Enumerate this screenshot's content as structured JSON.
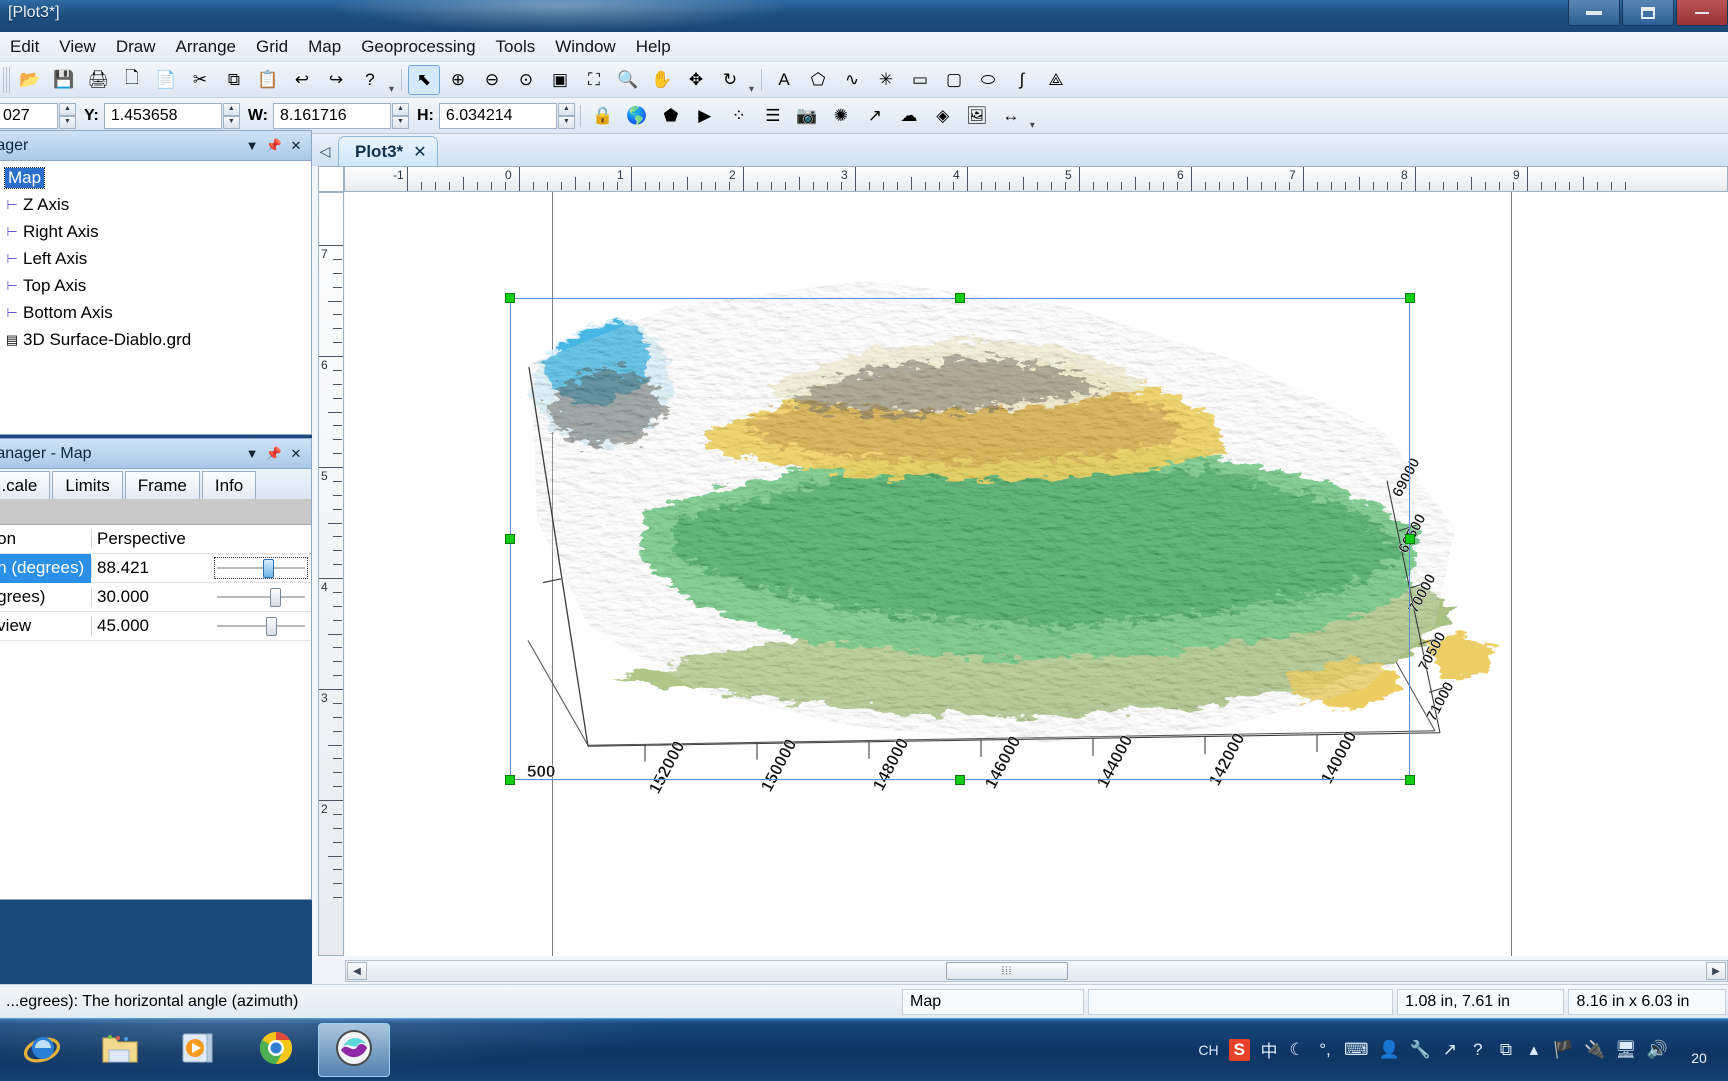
{
  "window": {
    "title": "[Plot3*]",
    "buttons": {
      "minimize": "minimize",
      "maximize": "maximize",
      "close": "close"
    }
  },
  "menu": {
    "items": [
      "Edit",
      "View",
      "Draw",
      "Arrange",
      "Grid",
      "Map",
      "Geoprocessing",
      "Tools",
      "Window",
      "Help"
    ]
  },
  "toolbars": {
    "standard": [
      {
        "name": "open-icon",
        "glyph": "📂"
      },
      {
        "name": "save-icon",
        "glyph": "💾"
      },
      {
        "name": "print-icon",
        "glyph": "🖨"
      },
      {
        "name": "print-preview-icon",
        "glyph": "🗋"
      },
      {
        "name": "export-icon",
        "glyph": "📄"
      },
      {
        "name": "cut-icon",
        "glyph": "✂"
      },
      {
        "name": "copy-icon",
        "glyph": "⧉"
      },
      {
        "name": "paste-icon",
        "glyph": "📋"
      },
      {
        "name": "undo-icon",
        "glyph": "↩"
      },
      {
        "name": "redo-icon",
        "glyph": "↪"
      },
      {
        "name": "help-pointer-icon",
        "glyph": "?"
      }
    ],
    "view": [
      {
        "name": "select-tool-icon",
        "glyph": "⬉"
      },
      {
        "name": "zoom-in-icon",
        "glyph": "⊕"
      },
      {
        "name": "zoom-out-icon",
        "glyph": "⊖"
      },
      {
        "name": "zoom-selected-icon",
        "glyph": "⊙"
      },
      {
        "name": "zoom-rectangle-icon",
        "glyph": "▣"
      },
      {
        "name": "fit-window-icon",
        "glyph": "⛶"
      },
      {
        "name": "zoom-page-icon",
        "glyph": "🔍"
      },
      {
        "name": "pan-icon",
        "glyph": "✋"
      },
      {
        "name": "trackball-rotate-icon",
        "glyph": "✥"
      },
      {
        "name": "reset-rotate-icon",
        "glyph": "↻"
      }
    ],
    "draw": [
      {
        "name": "text-icon",
        "glyph": "A"
      },
      {
        "name": "polygon-icon",
        "glyph": "⬠"
      },
      {
        "name": "polyline-icon",
        "glyph": "∿"
      },
      {
        "name": "symbol-icon",
        "glyph": "✳"
      },
      {
        "name": "rectangle-icon",
        "glyph": "▭"
      },
      {
        "name": "rounded-rectangle-icon",
        "glyph": "▢"
      },
      {
        "name": "ellipse-icon",
        "glyph": "⬭"
      },
      {
        "name": "spline-icon",
        "glyph": "∫"
      },
      {
        "name": "reshape-icon",
        "glyph": "⟁"
      }
    ],
    "map": [
      {
        "name": "lock-icon",
        "glyph": "🔒"
      },
      {
        "name": "new-base-map-icon",
        "glyph": "🌎"
      },
      {
        "name": "base-map-outline-icon",
        "glyph": "⬟"
      },
      {
        "name": "color-relief-map-icon",
        "glyph": "▶"
      },
      {
        "name": "post-map-icon",
        "glyph": "⁘"
      },
      {
        "name": "classed-post-map-icon",
        "glyph": "☰"
      },
      {
        "name": "image-map-icon",
        "glyph": "📷"
      },
      {
        "name": "shaded-relief-icon",
        "glyph": "✺"
      },
      {
        "name": "vector-map-icon",
        "glyph": "↗"
      },
      {
        "name": "watershed-icon",
        "glyph": "☁"
      },
      {
        "name": "wireframe-icon",
        "glyph": "◈"
      },
      {
        "name": "surface-map-icon",
        "glyph": "🖼"
      },
      {
        "name": "stack-maps-icon",
        "glyph": "↔"
      }
    ]
  },
  "coordbar": {
    "x_value": "027",
    "y_label": "Y:",
    "y_value": "1.453658",
    "w_label": "W:",
    "w_value": "8.161716",
    "h_label": "H:",
    "h_value": "6.034214"
  },
  "object_manager": {
    "title": "...ager",
    "items": [
      {
        "label": "Map",
        "icon": "map-icon",
        "selected": true,
        "indent": 0
      },
      {
        "label": "Z Axis",
        "icon": "axis-icon",
        "selected": false,
        "indent": 1
      },
      {
        "label": "Right Axis",
        "icon": "axis-icon",
        "selected": false,
        "indent": 1
      },
      {
        "label": "Left Axis",
        "icon": "axis-icon",
        "selected": false,
        "indent": 1
      },
      {
        "label": "Top Axis",
        "icon": "axis-icon",
        "selected": false,
        "indent": 1
      },
      {
        "label": "Bottom Axis",
        "icon": "axis-icon",
        "selected": false,
        "indent": 1
      },
      {
        "label": "3D Surface-Diablo.grd",
        "icon": "surface-icon",
        "selected": false,
        "indent": 1
      }
    ]
  },
  "property_manager": {
    "title": "...anager - Map",
    "tabs": [
      "...cale",
      "Limits",
      "Frame",
      "Info"
    ],
    "rows": [
      {
        "key": "...on",
        "value": "Perspective",
        "selected": false,
        "slider": null
      },
      {
        "key": "...n (degrees)",
        "value": "88.421",
        "selected": true,
        "slider": 52
      },
      {
        "key": "...grees)",
        "value": "30.000",
        "selected": false,
        "slider": 60
      },
      {
        "key": "...view",
        "value": "45.000",
        "selected": false,
        "slider": 55
      }
    ]
  },
  "document": {
    "tab_label": "Plot3*",
    "tab_close": "✕",
    "ruler_h_labels": [
      "-1",
      "0",
      "1",
      "2",
      "3",
      "4",
      "5",
      "6",
      "7",
      "8",
      "9"
    ],
    "ruler_v_labels": [
      "7",
      "6",
      "5",
      "4",
      "3",
      "2"
    ]
  },
  "chart_data": {
    "type": "surface3d",
    "title": "3D Surface-Diablo.grd",
    "projection": "Perspective",
    "rotation_degrees": 88.421,
    "tilt_degrees": 30.0,
    "field_of_view": 45.0,
    "z_axis": {
      "labels": [
        "500"
      ]
    },
    "bottom_axis": {
      "name": "Bottom Axis",
      "labels": [
        "152000",
        "150000",
        "148000",
        "146000",
        "144000",
        "142000",
        "140000"
      ]
    },
    "right_axis": {
      "name": "Right Axis",
      "labels": [
        "71000",
        "70500",
        "70000",
        "69500",
        "69000"
      ]
    },
    "colormap": [
      "#1d9ad4",
      "#8fd7ef",
      "#f2f6d8",
      "#f5d23a",
      "#c9a23d",
      "#6aca7c",
      "#2f9e52",
      "#2a7a3f"
    ]
  },
  "status": {
    "hint": "...egrees): The horizontal angle (azimuth)",
    "object": "Map",
    "blank": "",
    "position": "1.08 in, 7.61 in",
    "size": "8.16 in x 6.03 in"
  },
  "taskbar": {
    "buttons": [
      {
        "name": "internet-explorer-icon",
        "label": "Internet Explorer"
      },
      {
        "name": "file-explorer-icon",
        "label": "Windows Explorer"
      },
      {
        "name": "media-player-icon",
        "label": "Windows Media Player"
      },
      {
        "name": "google-chrome-icon",
        "label": "Google Chrome"
      },
      {
        "name": "surfer-app-icon",
        "label": "Surfer"
      }
    ],
    "tray": [
      "CH",
      "S",
      "中",
      "☾",
      "°,",
      "⌨",
      "👤",
      "🔧",
      "↗",
      "?",
      "⧉",
      "▴",
      "🏴",
      "🔌",
      "🖥",
      "🔊"
    ],
    "clock": "20"
  }
}
